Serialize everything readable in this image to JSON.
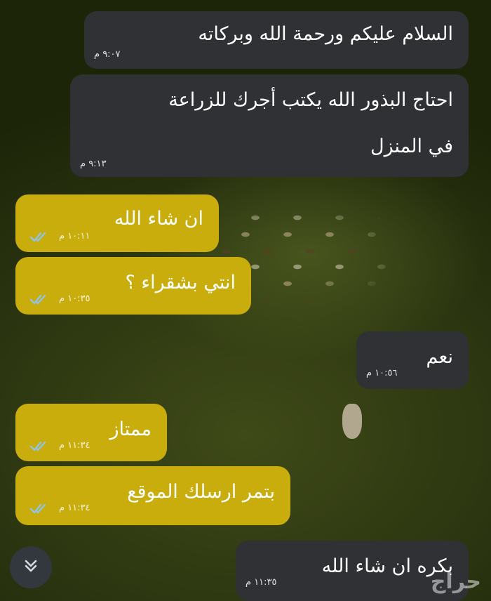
{
  "messages": [
    {
      "text": "السلام عليكم ورحمة الله وبركاته",
      "time": "٩:٠٧ م"
    },
    {
      "line1": "احتاج البذور الله يكتب أجرك للزراعة",
      "line2": "في المنزل",
      "time": "٩:١٣ م"
    },
    {
      "text": "ان شاء الله",
      "time": "١٠:١١ م"
    },
    {
      "text": "انتي بشقراء ؟",
      "time": "١٠:٣٥ م"
    },
    {
      "text": "نعم",
      "time": "١٠:٥٦ م"
    },
    {
      "text": "ممتاز",
      "time": "١١:٣٤ م"
    },
    {
      "text": "بتمر ارسلك الموقع",
      "time": "١١:٣٤ م"
    },
    {
      "text": "بكره ان شاء الله",
      "time": "١١:٣٥ م"
    }
  ],
  "watermark": "حراج",
  "colors": {
    "incoming_bubble": "#2f3134",
    "outgoing_bubble": "#c8ad0d",
    "read_ticks": "#8fc3e8"
  },
  "icons": {
    "read_receipt": "double-check-icon",
    "scroll_down": "chevron-double-down-icon"
  }
}
